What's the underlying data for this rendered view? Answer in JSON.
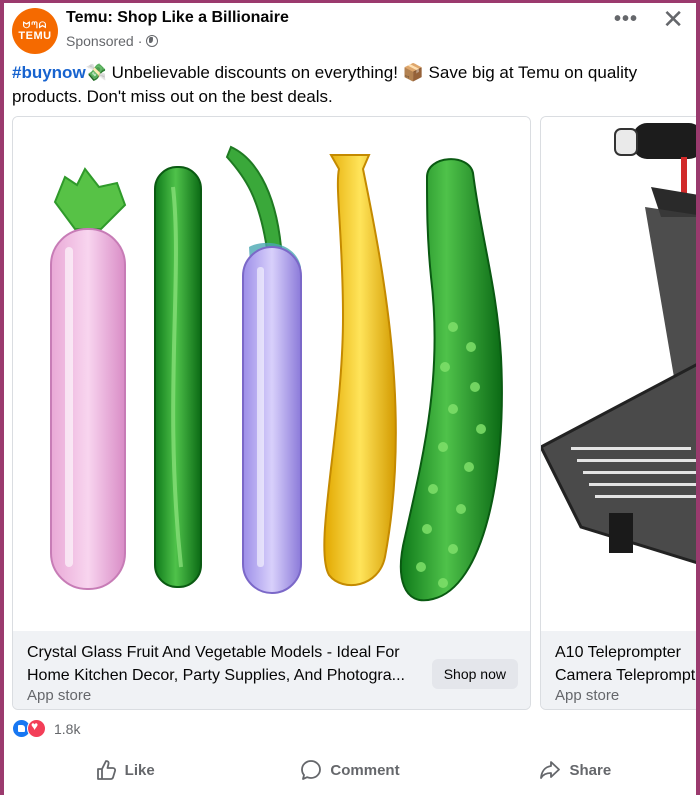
{
  "post": {
    "page_name": "Temu: Shop Like a Billionaire",
    "sponsored": "Sponsored",
    "separator": "·",
    "avatar": {
      "glyphs": "ᗢᘉᗣ",
      "brand": "TEMU",
      "color": "#f56a00"
    },
    "text": {
      "hashtag": "#buynow",
      "emoji1": "💸",
      "part1": " Unbelievable discounts on everything! ",
      "emoji2": "📦",
      "part2": " Save big at Temu on quality products. Don't miss out on the best deals."
    }
  },
  "carousel": [
    {
      "title": "Crystal Glass Fruit And Vegetable Models - Ideal For Home Kitchen Decor, Party Supplies, And Photogra...",
      "subtitle": "App store",
      "cta": "Shop now"
    },
    {
      "title_line1": "A10 Teleprompter",
      "title_line2": "Camera Teleprompt",
      "subtitle": "App store"
    }
  ],
  "reactions": {
    "count": "1.8k"
  },
  "actions": {
    "like": "Like",
    "comment": "Comment",
    "share": "Share"
  },
  "colors": {
    "accent": "#1763cf",
    "frame": "#9b3a6e",
    "muted": "#65676b"
  }
}
